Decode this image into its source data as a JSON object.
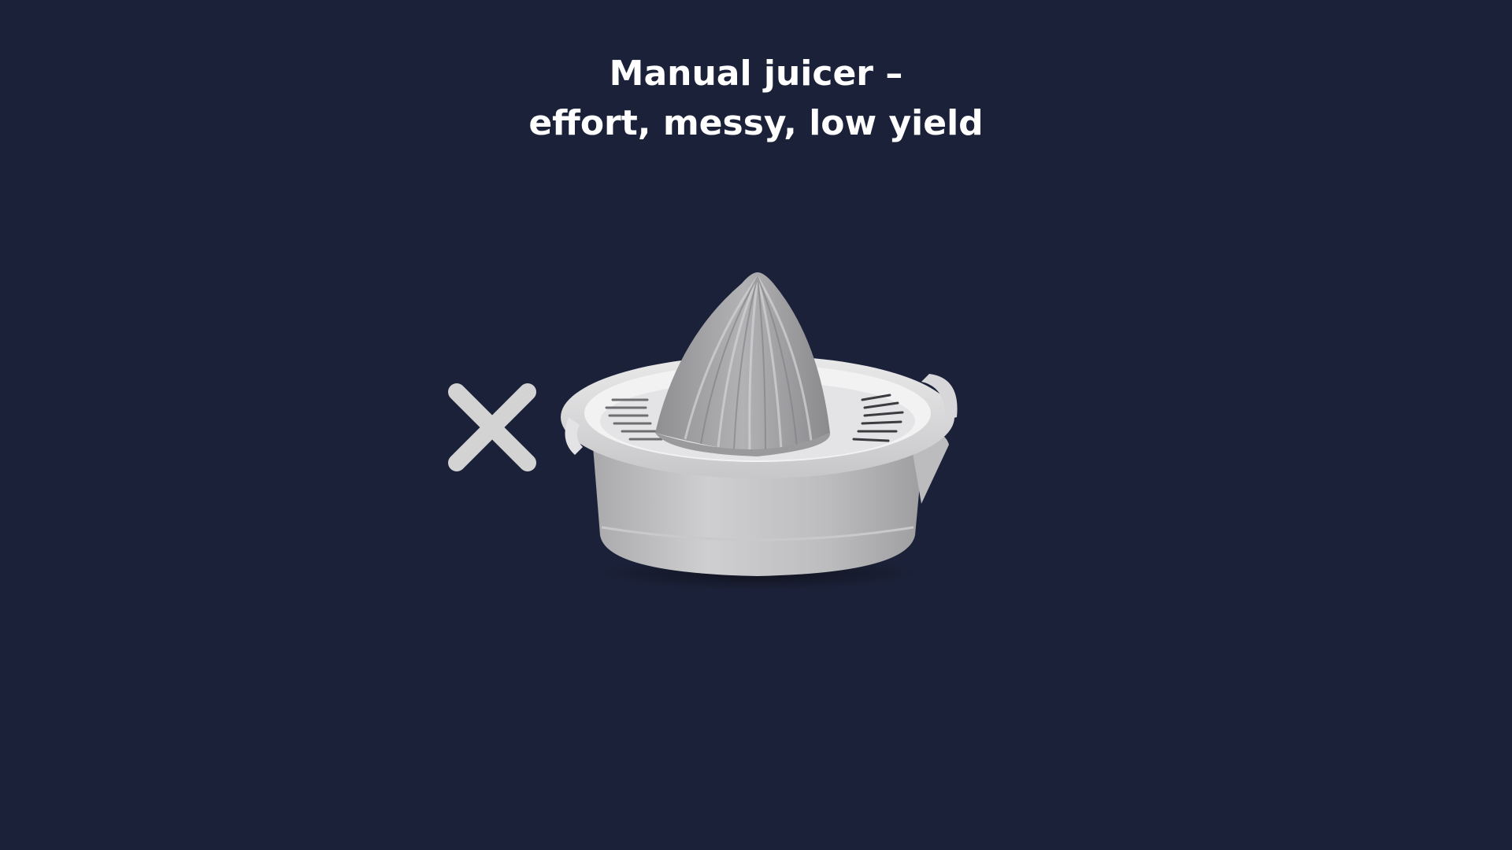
{
  "slide": {
    "title_line1": "Manual juicer –",
    "title_line2": "effort, messy, low yield",
    "background_color": "#1b2138",
    "title_color": "#ffffff"
  },
  "icons": {
    "negative_marker": "close-icon",
    "negative_marker_color": "#d3d3d3"
  },
  "image": {
    "subject": "manual citrus juicer"
  }
}
